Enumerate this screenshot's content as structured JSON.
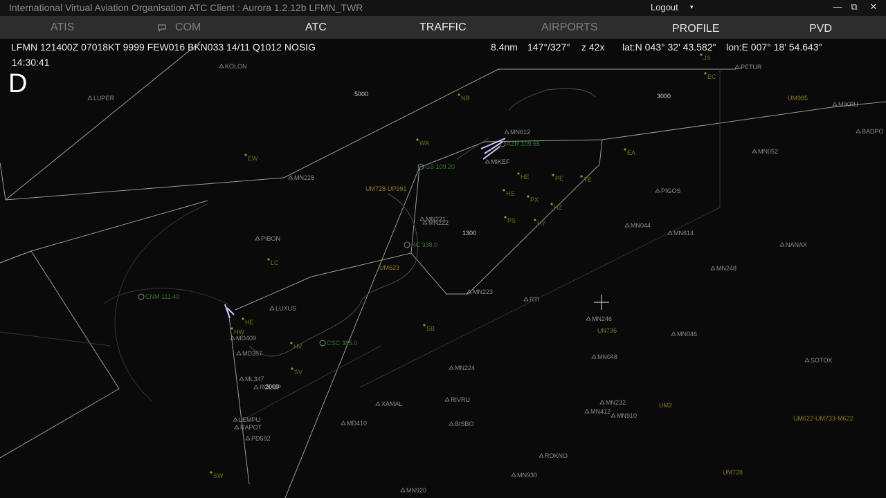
{
  "window": {
    "title": "International Virtual Aviation Organisation  ATC Client : Aurora 1.2.12b  LFMN_TWR",
    "logout_label": "Logout",
    "caret": "▾",
    "minimize": "—",
    "restore": "⧉",
    "close": "✕"
  },
  "menu": {
    "atis": "ATIS",
    "com": "COM",
    "atc": "ATC",
    "traffic": "TRAFFIC",
    "airports": "AIRPORTS",
    "profile": "PROFILE",
    "pvd": "PVD"
  },
  "hud": {
    "metar": "LFMN 121400Z 07018KT 9999 FEW016 BKN033 14/11 Q1012 NOSIG",
    "time": "14:30:41",
    "atis_letter": "D",
    "range": "8.4nm",
    "bearing": "147°/327°",
    "zoom": "z 42x",
    "lat": "lat:N 043° 32' 43.582\"",
    "lon": "lon:E 007° 18' 54.643\""
  },
  "colors": {
    "fix": "#8a8a8a",
    "airway": "#8a7a2a",
    "vor": "#2d7a2d",
    "airport": "#6b7a12",
    "boundary": "#9a9a9a",
    "altitude": "#d0d0d0"
  },
  "map": {
    "fixes": [
      "KOLON",
      "LUPER",
      "MN228",
      "PIBON",
      "LUXUS",
      "MD409",
      "MD357",
      "ML347",
      "ROLUP",
      "LEMPU",
      "RAPOT",
      "PD592",
      "MD410",
      "BISBO",
      "RIVRU",
      "XAMAL",
      "MN224",
      "MN223",
      "RTI",
      "MN246",
      "MN048",
      "MN046",
      "MN232",
      "MN412",
      "MN910",
      "ROKNO",
      "MN930",
      "MN920",
      "MN221",
      "MN222",
      "PIGOS",
      "MN044",
      "MN614",
      "MN248",
      "NANAX",
      "SOTOX",
      "MN052",
      "MIKRU",
      "BADPO",
      "PETUR",
      "MN612",
      "MIKEF"
    ],
    "airways": [
      "UN736",
      "UM985",
      "UM728-UP991",
      "UM623",
      "UM2",
      "UM622-UM733-M622",
      "UM728"
    ],
    "navaids": [
      "AZR 109.65",
      "GS 109.20",
      "NC 338.0",
      "CNM 111.40",
      "CSC 385.0"
    ],
    "altitudes": [
      "5000",
      "3000",
      "1300",
      "2000"
    ],
    "points": [
      "NB",
      "WA",
      "EW",
      "HE",
      "PE",
      "TE",
      "HS",
      "PX",
      "HZ",
      "PS",
      "HY",
      "LC",
      "HE",
      "HW",
      "HV",
      "SV",
      "SB",
      "SW",
      "EA",
      "JS",
      "EC"
    ]
  }
}
